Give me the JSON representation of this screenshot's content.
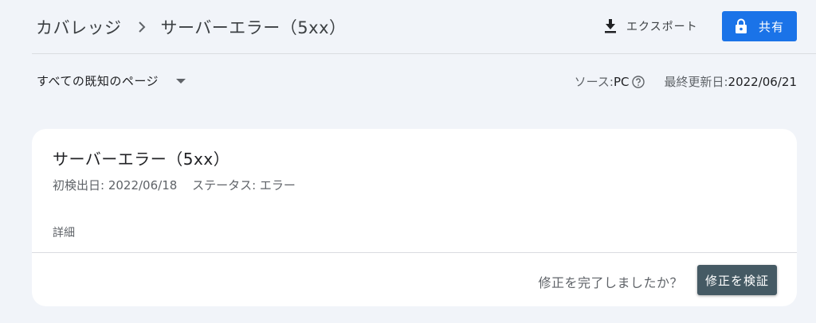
{
  "header": {
    "breadcrumb_parent": "カバレッジ",
    "breadcrumb_current": "サーバーエラー（5xx）",
    "export_label": "エクスポート",
    "share_label": "共有"
  },
  "filter": {
    "selected": "すべての既知のページ"
  },
  "meta": {
    "source_label": "ソース: ",
    "source_value": "PC",
    "updated_label": "最終更新日: ",
    "updated_value": "2022/06/21"
  },
  "card": {
    "title": "サーバーエラー（5xx）",
    "first_detected": "初検出日: 2022/06/18",
    "status": "ステータス: エラー",
    "details_label": "詳細",
    "fix_question": "修正を完了しましたか？",
    "verify_button": "修正を検証"
  },
  "colors": {
    "background": "#f1f4f9",
    "share_button": "#1a73e8",
    "verify_button": "#455a64"
  },
  "icons": {
    "breadcrumb_separator": "chevron-right-icon",
    "export": "download-icon",
    "share": "lock-icon",
    "filter": "caret-down-icon",
    "help": "help-circle-icon"
  }
}
